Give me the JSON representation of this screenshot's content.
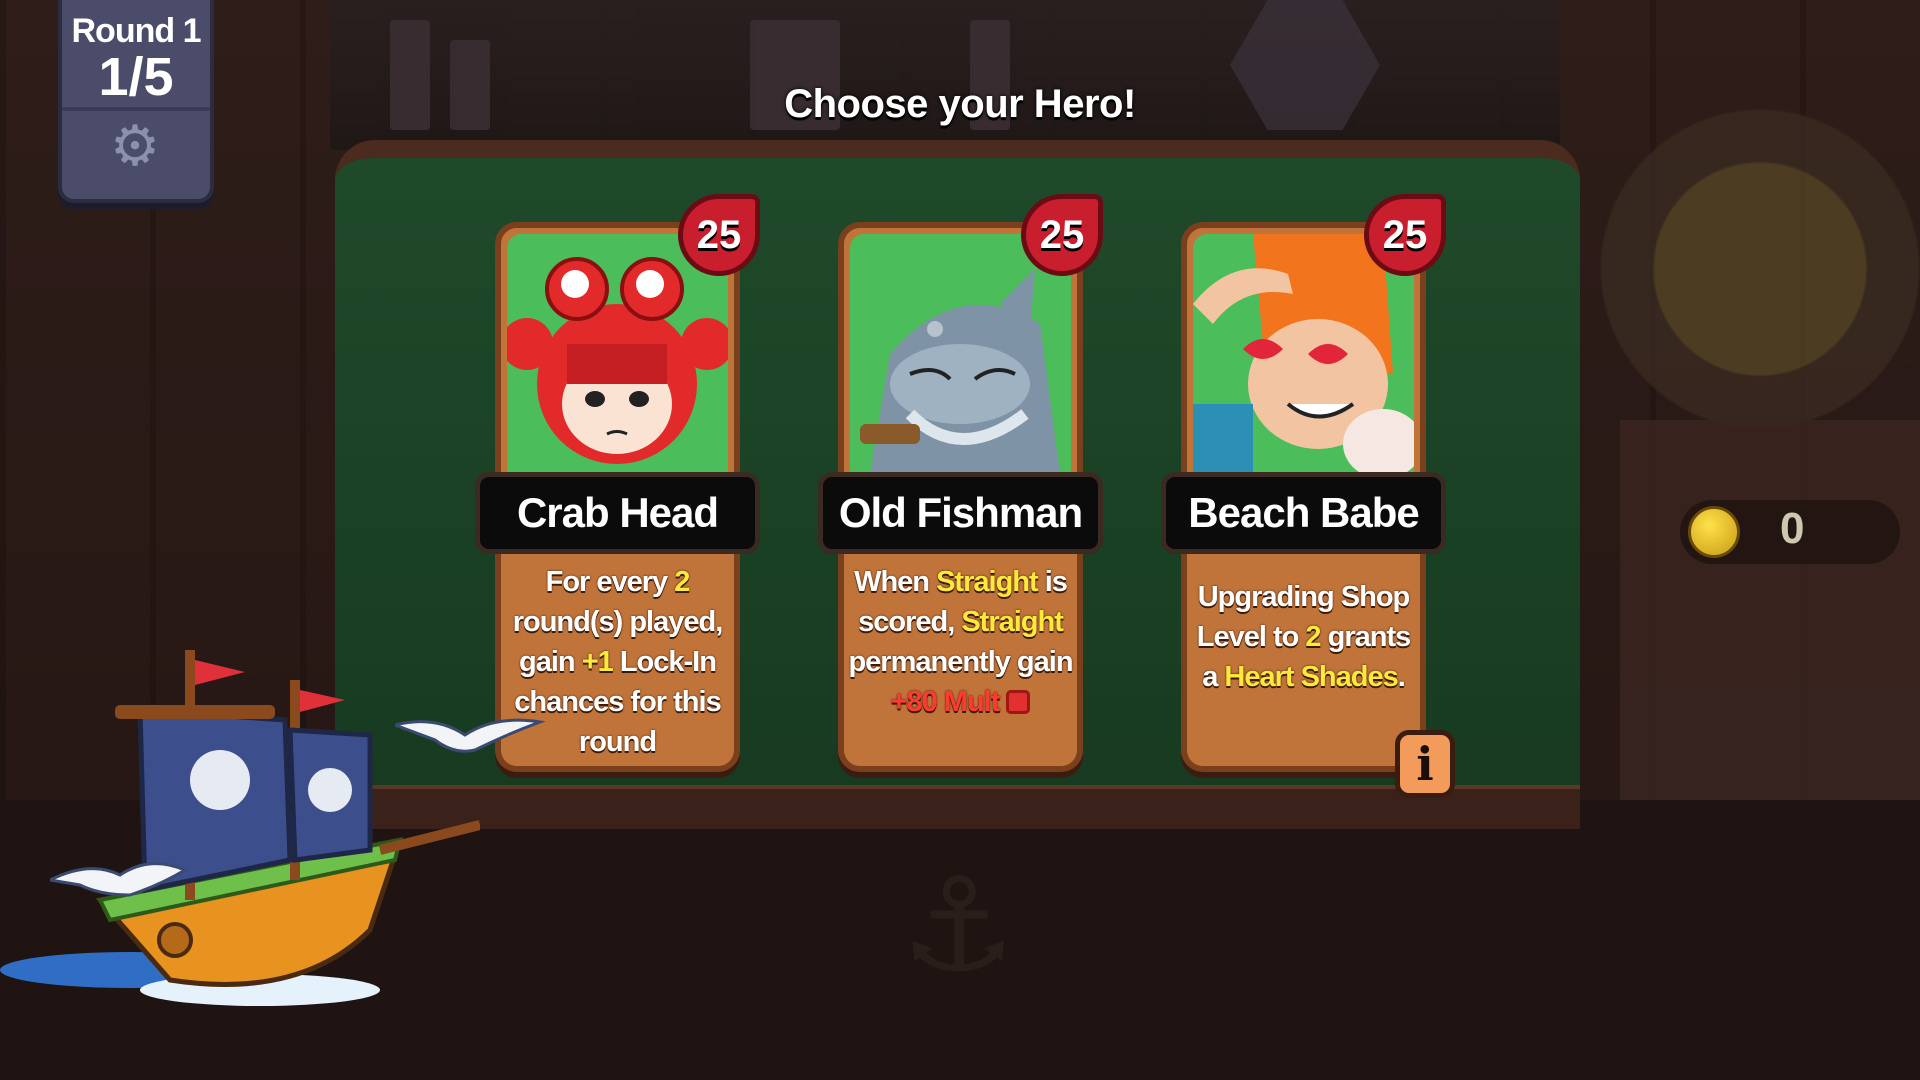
{
  "hud": {
    "round_label": "Round 1",
    "round_count": "1/5",
    "coins": "0"
  },
  "title": "Choose your Hero!",
  "icons": {
    "settings": "gear-icon",
    "info": "info-icon",
    "coin": "coin-icon",
    "dice": "dice-icon"
  },
  "colors": {
    "highlight_yellow": "#ffe93b",
    "highlight_red": "#ff3b30",
    "card_body": "#c0743a",
    "cost_badge": "#c81e2d",
    "board_green": "#1f4a2a"
  },
  "cards": [
    {
      "name": "Crab Head",
      "cost": "25",
      "desc": [
        "For every ",
        "2",
        " round(s) played, gain ",
        "+1",
        " Lock-In chances for this round"
      ]
    },
    {
      "name": "Old Fishman",
      "cost": "25",
      "desc": [
        "When ",
        "Straight",
        " is scored, ",
        "Straight",
        " permanently gain ",
        "+80 Mult"
      ]
    },
    {
      "name": "Beach Babe",
      "cost": "25",
      "desc": [
        "Upgrading Shop Level to ",
        "2",
        " grants a ",
        "Heart Shades",
        "."
      ]
    }
  ],
  "info_button": "i"
}
